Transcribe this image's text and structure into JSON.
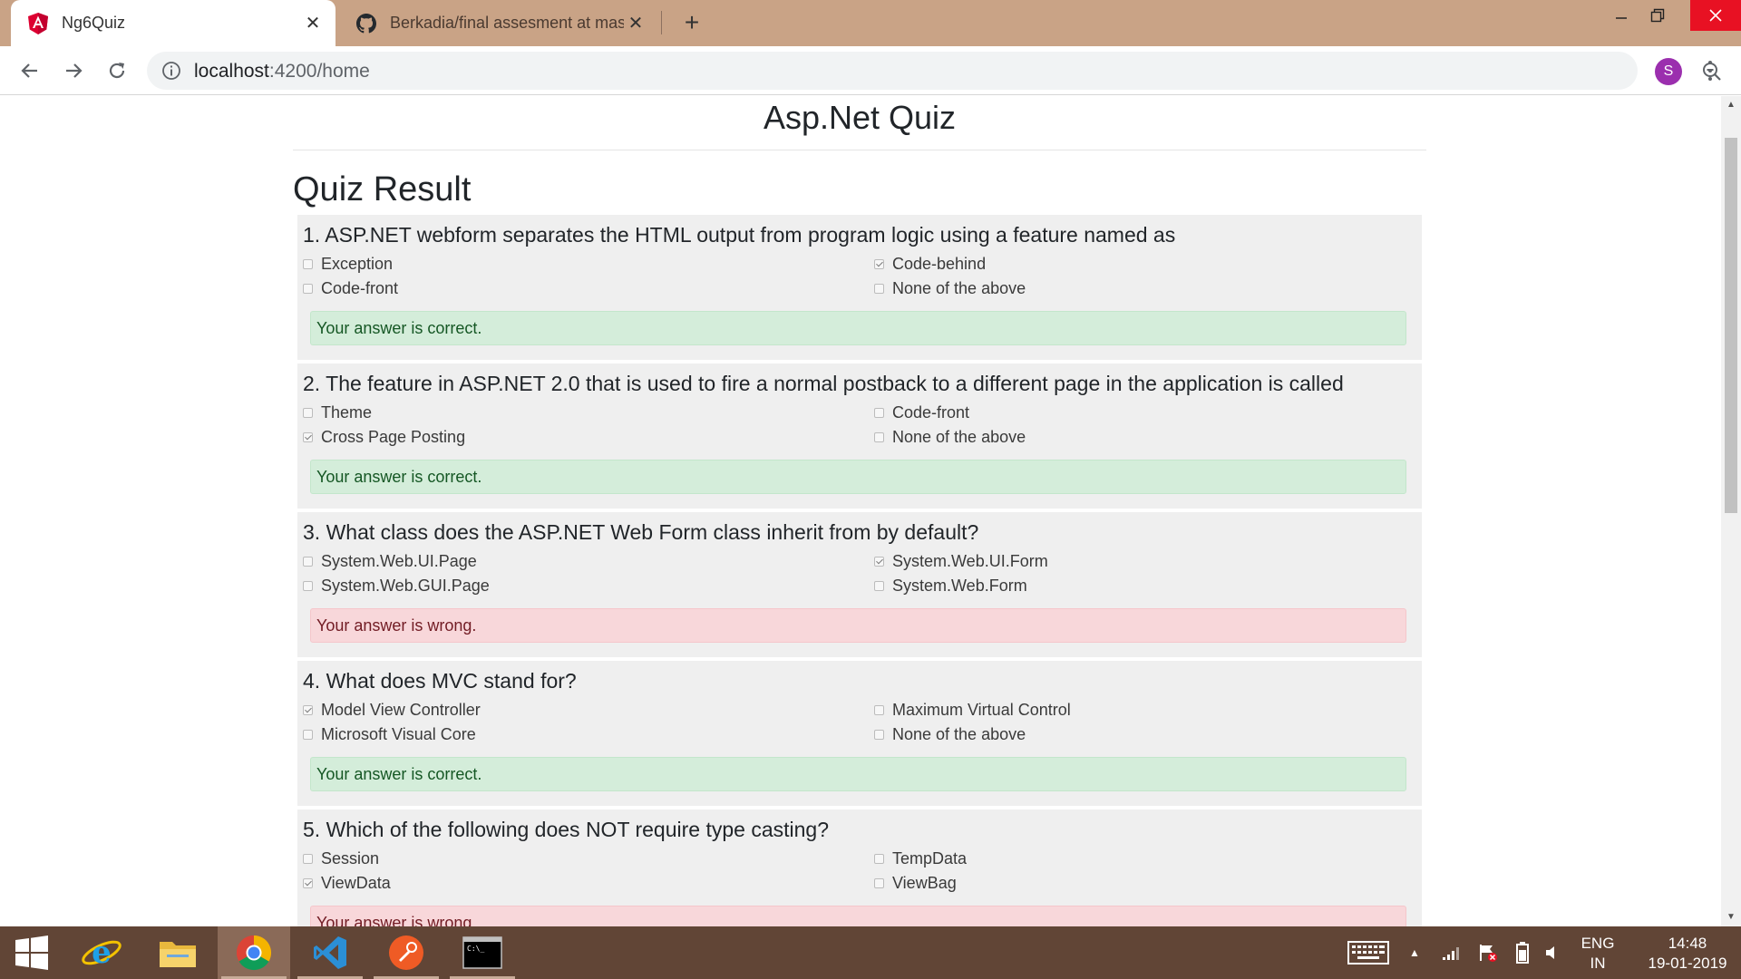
{
  "browser": {
    "tabs": [
      {
        "title": "Ng6Quiz",
        "favicon": "angular-icon",
        "active": true
      },
      {
        "title": "Berkadia/final assesment at mast",
        "favicon": "github-icon",
        "active": false
      }
    ],
    "url_host": "localhost",
    "url_path": ":4200/home",
    "profile_initial": "S"
  },
  "page": {
    "title": "Asp.Net Quiz",
    "heading": "Quiz Result",
    "questions": [
      {
        "text": "1. ASP.NET webform separates the HTML output from program logic using a feature named as",
        "options": [
          {
            "label": "Exception",
            "checked": false
          },
          {
            "label": "Code-behind",
            "checked": true
          },
          {
            "label": "Code-front",
            "checked": false
          },
          {
            "label": "None of the above",
            "checked": false
          }
        ],
        "result": "Your answer is correct.",
        "status": "correct"
      },
      {
        "text": "2. The feature in ASP.NET 2.0 that is used to fire a normal postback to a different page in the application is called",
        "options": [
          {
            "label": "Theme",
            "checked": false
          },
          {
            "label": "Code-front",
            "checked": false
          },
          {
            "label": "Cross Page Posting",
            "checked": true
          },
          {
            "label": "None of the above",
            "checked": false
          }
        ],
        "result": "Your answer is correct.",
        "status": "correct"
      },
      {
        "text": "3. What class does the ASP.NET Web Form class inherit from by default?",
        "options": [
          {
            "label": "System.Web.UI.Page",
            "checked": false
          },
          {
            "label": "System.Web.UI.Form",
            "checked": true
          },
          {
            "label": "System.Web.GUI.Page",
            "checked": false
          },
          {
            "label": "System.Web.Form",
            "checked": false
          }
        ],
        "result": "Your answer is wrong.",
        "status": "wrong"
      },
      {
        "text": "4. What does MVC stand for?",
        "options": [
          {
            "label": "Model View Controller",
            "checked": true
          },
          {
            "label": "Maximum Virtual Control",
            "checked": false
          },
          {
            "label": "Microsoft Visual Core",
            "checked": false
          },
          {
            "label": "None of the above",
            "checked": false
          }
        ],
        "result": "Your answer is correct.",
        "status": "correct"
      },
      {
        "text": "5. Which of the following does NOT require type casting?",
        "options": [
          {
            "label": "Session",
            "checked": false
          },
          {
            "label": "TempData",
            "checked": false
          },
          {
            "label": "ViewData",
            "checked": true
          },
          {
            "label": "ViewBag",
            "checked": false
          }
        ],
        "result": "Your answer is wrong.",
        "status": "wrong"
      }
    ]
  },
  "taskbar": {
    "apps": [
      "internet-explorer-icon",
      "file-explorer-icon",
      "chrome-icon",
      "vscode-icon",
      "postman-icon",
      "command-prompt-icon"
    ],
    "language_top": "ENG",
    "language_bottom": "IN",
    "time": "14:48",
    "date": "19-01-2019"
  },
  "colors": {
    "tabbar": "#c9a386",
    "taskbar": "#614536",
    "correct_bg": "#d4edda",
    "wrong_bg": "#f8d7da"
  }
}
